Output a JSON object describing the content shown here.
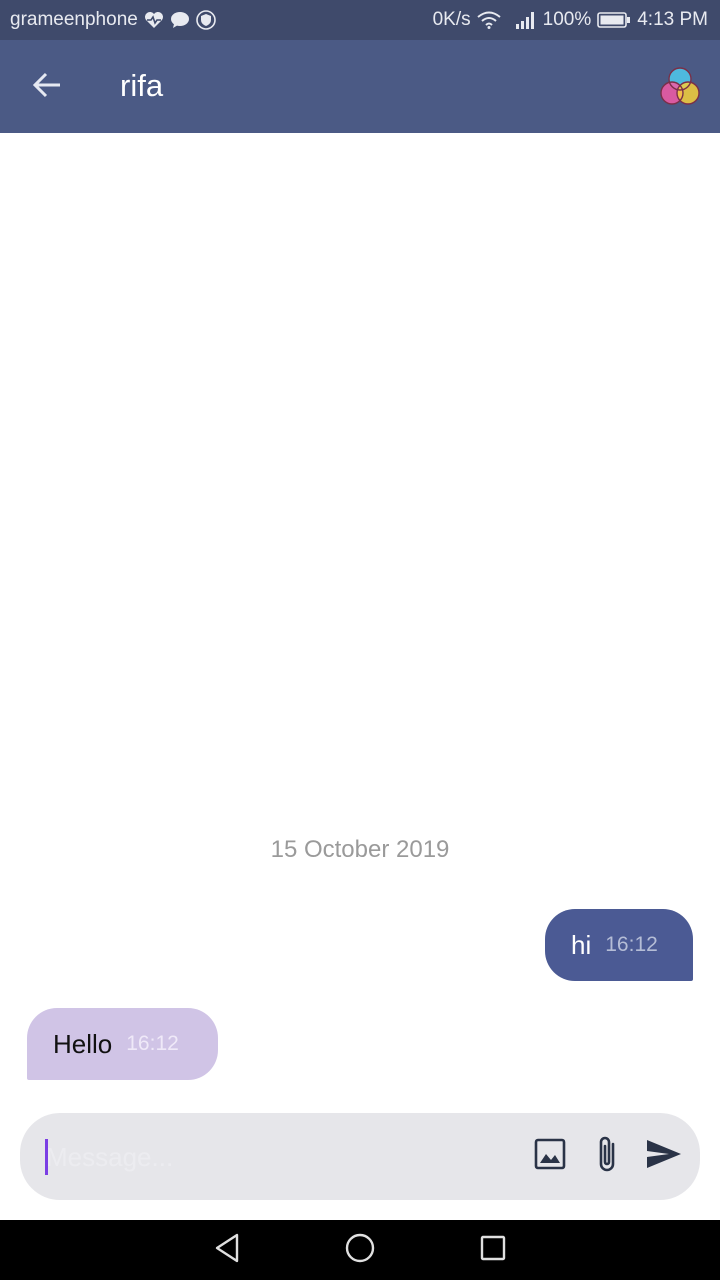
{
  "status_bar": {
    "carrier": "grameenphone",
    "speed": "0K/s",
    "battery": "100%",
    "time": "4:13 PM",
    "icons": [
      "heart-pulse-icon",
      "chat-bubble-icon",
      "shield-icon",
      "wifi-icon",
      "signal-icon",
      "battery-icon"
    ]
  },
  "header": {
    "title": "rifa",
    "back_icon": "arrow-left-icon",
    "theme_icon": "color-circles-icon"
  },
  "conversation": {
    "date": "15 October 2019",
    "messages": [
      {
        "direction": "outgoing",
        "text": "hi",
        "time": "16:12"
      },
      {
        "direction": "incoming",
        "text": "Hello",
        "time": "16:12"
      }
    ]
  },
  "composer": {
    "placeholder": "Message...",
    "value": "",
    "icons": [
      "image-icon",
      "paperclip-icon",
      "send-icon"
    ]
  },
  "nav_bar": {
    "icons": [
      "back-triangle-icon",
      "home-circle-icon",
      "recents-square-icon"
    ]
  },
  "colors": {
    "status_bar": "#3f4a6b",
    "app_bar": "#4b5a85",
    "outgoing_bubble": "#4b5a94",
    "incoming_bubble": "#d0c4e6",
    "composer": "#e6e6ea",
    "caret": "#7b3fe4"
  }
}
